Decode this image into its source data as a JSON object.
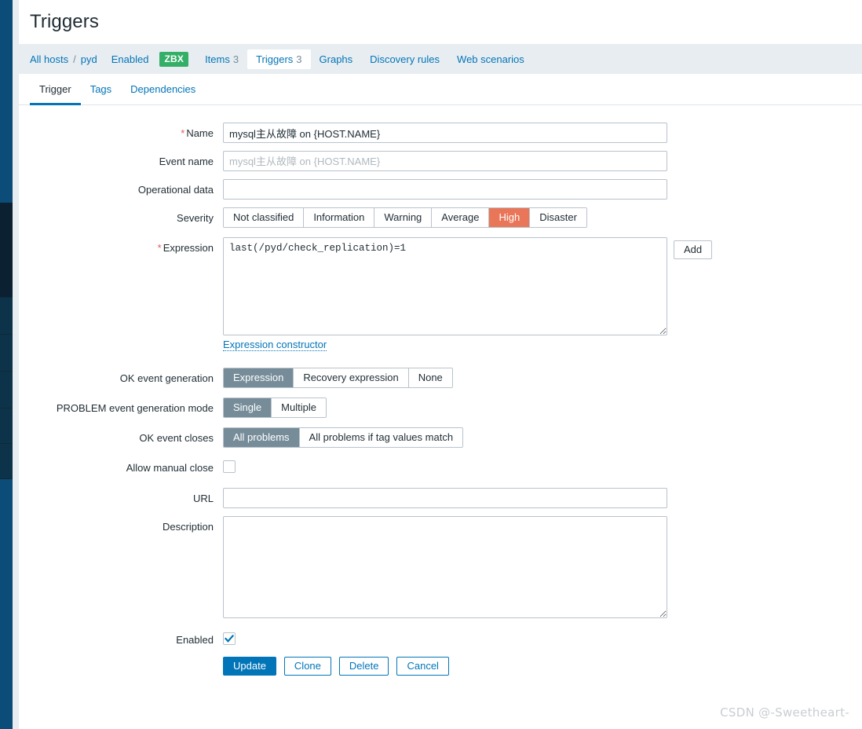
{
  "page": {
    "title": "Triggers"
  },
  "host_nav": {
    "all_hosts": "All hosts",
    "separator": "/",
    "host": "pyd",
    "status": "Enabled",
    "agent_badge": "ZBX",
    "items_label": "Items",
    "items_count": "3",
    "triggers_label": "Triggers",
    "triggers_count": "3",
    "graphs": "Graphs",
    "discovery_rules": "Discovery rules",
    "web_scenarios": "Web scenarios"
  },
  "subtabs": [
    {
      "label": "Trigger",
      "active": true
    },
    {
      "label": "Tags",
      "active": false
    },
    {
      "label": "Dependencies",
      "active": false
    }
  ],
  "form": {
    "name": {
      "label": "Name",
      "required": true,
      "value": "mysql主从故障 on {HOST.NAME}",
      "placeholder": ""
    },
    "event_name": {
      "label": "Event name",
      "required": false,
      "value": "",
      "placeholder": "mysql主从故障 on {HOST.NAME}"
    },
    "operational_data": {
      "label": "Operational data",
      "required": false,
      "value": "",
      "placeholder": ""
    },
    "severity": {
      "label": "Severity",
      "options": [
        "Not classified",
        "Information",
        "Warning",
        "Average",
        "High",
        "Disaster"
      ],
      "selected": "High",
      "selected_color": "#e97659"
    },
    "expression": {
      "label": "Expression",
      "required": true,
      "value": "last(/pyd/check_replication)=1",
      "add_button": "Add",
      "constructor_link": "Expression constructor"
    },
    "ok_event_generation": {
      "label": "OK event generation",
      "options": [
        "Expression",
        "Recovery expression",
        "None"
      ],
      "selected": "Expression"
    },
    "problem_event_generation_mode": {
      "label": "PROBLEM event generation mode",
      "options": [
        "Single",
        "Multiple"
      ],
      "selected": "Single"
    },
    "ok_event_closes": {
      "label": "OK event closes",
      "options": [
        "All problems",
        "All problems if tag values match"
      ],
      "selected": "All problems"
    },
    "allow_manual_close": {
      "label": "Allow manual close",
      "checked": false
    },
    "url": {
      "label": "URL",
      "value": "",
      "placeholder": ""
    },
    "description": {
      "label": "Description",
      "value": "",
      "placeholder": ""
    },
    "enabled": {
      "label": "Enabled",
      "checked": true
    }
  },
  "actions": {
    "update": "Update",
    "clone": "Clone",
    "delete": "Delete",
    "cancel": "Cancel"
  },
  "watermark": "CSDN @-Sweetheart-",
  "colors": {
    "accent": "#0275b8",
    "selected_segment": "#768d99",
    "severity_high": "#e97659",
    "status_enabled": "#429e47",
    "agent_badge": "#34af67",
    "rail": "#0c4c78"
  }
}
